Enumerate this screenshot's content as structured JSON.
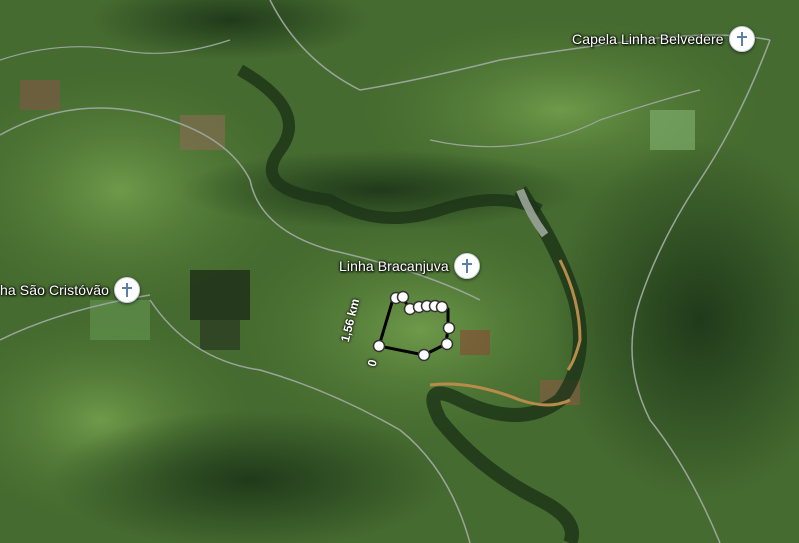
{
  "map": {
    "view": "satellite",
    "places": [
      {
        "id": "capela-linha-belvedere",
        "label": "Capela Linha Belvedere",
        "icon": "church-icon"
      },
      {
        "id": "linha-bracanjuva",
        "label": "Linha Bracanjuva",
        "icon": "church-icon"
      },
      {
        "id": "linha-sao-cristovao",
        "label": "ha São Cristóvão",
        "icon": "church-icon"
      }
    ],
    "measurement": {
      "distance_label": "1,56 km",
      "start_label": "0",
      "line_color": "#000000",
      "point_fill": "#ffffff"
    }
  }
}
